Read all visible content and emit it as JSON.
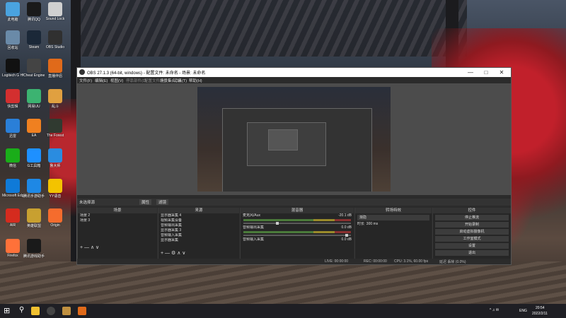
{
  "desktop": {
    "icons": [
      {
        "label": "此电脑",
        "color": "#4aa3df"
      },
      {
        "label": "腾讯QQ",
        "color": "#1a1a1a"
      },
      {
        "label": "Sound Lock",
        "color": "#d0d0d0"
      },
      {
        "label": "回收站",
        "color": "#6a8aa8"
      },
      {
        "label": "Steam",
        "color": "#1b2838"
      },
      {
        "label": "OBS Studio",
        "color": "#303030"
      },
      {
        "label": "Logitech G HUB",
        "color": "#111"
      },
      {
        "label": "Cheat Engine",
        "color": "#444"
      },
      {
        "label": "直播伴侣",
        "color": "#e06a1a"
      },
      {
        "label": "快剪辑",
        "color": "#d32f2f"
      },
      {
        "label": "网易UU",
        "color": "#3cb371"
      },
      {
        "label": "乱斗",
        "color": "#e0a040"
      },
      {
        "label": "迅雷",
        "color": "#2a7fd8"
      },
      {
        "label": "EA",
        "color": "#f08020"
      },
      {
        "label": "The Forest",
        "color": "#303a30"
      },
      {
        "label": "微信",
        "color": "#1aad19"
      },
      {
        "label": "G工具箱",
        "color": "#1e90ff"
      },
      {
        "label": "鲁大师",
        "color": "#2a8ce0"
      },
      {
        "label": "Microsoft Edge",
        "color": "#0f7ad8"
      },
      {
        "label": "腾讯手游助手",
        "color": "#1e88e5"
      },
      {
        "label": "YY语音",
        "color": "#f3c300"
      },
      {
        "label": "AIR",
        "color": "#d52b1e"
      },
      {
        "label": "英雄联盟",
        "color": "#c8a030"
      },
      {
        "label": "Origin",
        "color": "#f56c2d"
      },
      {
        "label": "Firefox",
        "color": "#ff7139"
      },
      {
        "label": "腾讯游戏助手",
        "color": "#1a1a1a"
      }
    ]
  },
  "obs": {
    "title": "OBS 27.1.3 (64-bit, windows) - 配置文件: 未命名 - 场景: 未命名",
    "menu": [
      "文件(F)",
      "编辑(E)",
      "视图(V)",
      "停靠部件(D)",
      "配置文件(P)",
      "场景集合(S)",
      "工具(T)",
      "帮助(H)"
    ],
    "scene_bar": {
      "label": "未选择源",
      "properties": "属性",
      "filters": "滤镜"
    },
    "docks": {
      "scenes": {
        "title": "场景",
        "items": [
          "场景 2",
          "场景 3"
        ]
      },
      "sources": {
        "title": "来源",
        "items": [
          "显示器采集 4",
          "视频采集设备",
          "音频输出采集",
          "显示器采集 3",
          "音频输入采集",
          "显示器采集"
        ]
      },
      "mixer": {
        "title": "混音器",
        "channels": [
          {
            "name": "麦克风/Aux",
            "db": "-20.1 dB"
          },
          {
            "name": "桌面音频",
            "db": "0.0 dB"
          },
          {
            "name": "音频输出采集",
            "db": "0.0 dB"
          },
          {
            "name": "音频输入采集",
            "db": "0.0 dB"
          }
        ]
      },
      "transitions": {
        "title": "转场特效",
        "type": "渐隐",
        "duration_label": "时长",
        "duration": "300 ms"
      },
      "controls": {
        "title": "控件",
        "buttons": [
          "停止推流",
          "开始录制",
          "启动虚拟摄像机",
          "工作室模式",
          "设置",
          "退出"
        ]
      }
    },
    "status": {
      "live": "LIVE: 00:00:00",
      "rec": "REC: 00:00:00",
      "cpu": "CPU: 3.1%, 60.00 fps",
      "dropped": "延迟 丢帧 (0.0%)"
    }
  },
  "taskbar": {
    "lang": "ENG",
    "time": "20:54",
    "date": "2022/2/11"
  }
}
